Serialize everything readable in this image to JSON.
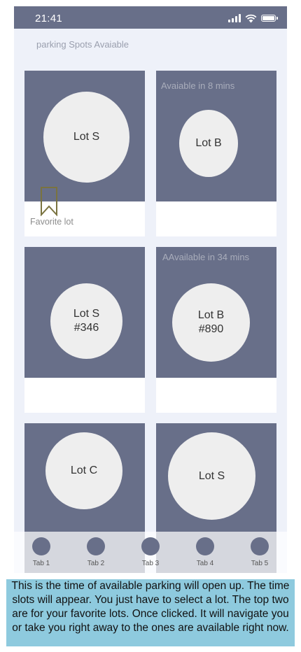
{
  "status_bar": {
    "time": "21:41",
    "icons": [
      "cellular-signal-icon",
      "wifi-icon",
      "battery-icon"
    ]
  },
  "header": {
    "title": "parking Spots Avaiable"
  },
  "cards": [
    {
      "lot": "Lot S",
      "availability": "",
      "favorite_label": "Favorite lot",
      "favorite_icon": "bookmark-icon"
    },
    {
      "lot": "Lot B",
      "availability": "Avaiable in 8 mins"
    },
    {
      "lot": "Lot S\n#346",
      "availability": ""
    },
    {
      "lot": "Lot B\n#890",
      "availability": "AAvailable in 34 mins"
    },
    {
      "lot": "Lot C",
      "availability": ""
    },
    {
      "lot": "Lot S",
      "availability": ""
    }
  ],
  "tabs": [
    {
      "label": "Tab 1"
    },
    {
      "label": "Tab 2"
    },
    {
      "label": "Tab 3"
    },
    {
      "label": "Tab 4"
    },
    {
      "label": "Tab 5"
    }
  ],
  "annotation": {
    "text": "This is the time of available parking will open up. The time slots will appear. You just have to select a lot. The top two are for your favorite lots. Once clicked. It will navigate you or take you right away to the ones are available right now."
  },
  "colors": {
    "accent": "#686f89",
    "background": "#eef1f9",
    "circle": "#eeeeee",
    "bookmark": "#7a7340",
    "annotation_bg": "#8ecade"
  }
}
